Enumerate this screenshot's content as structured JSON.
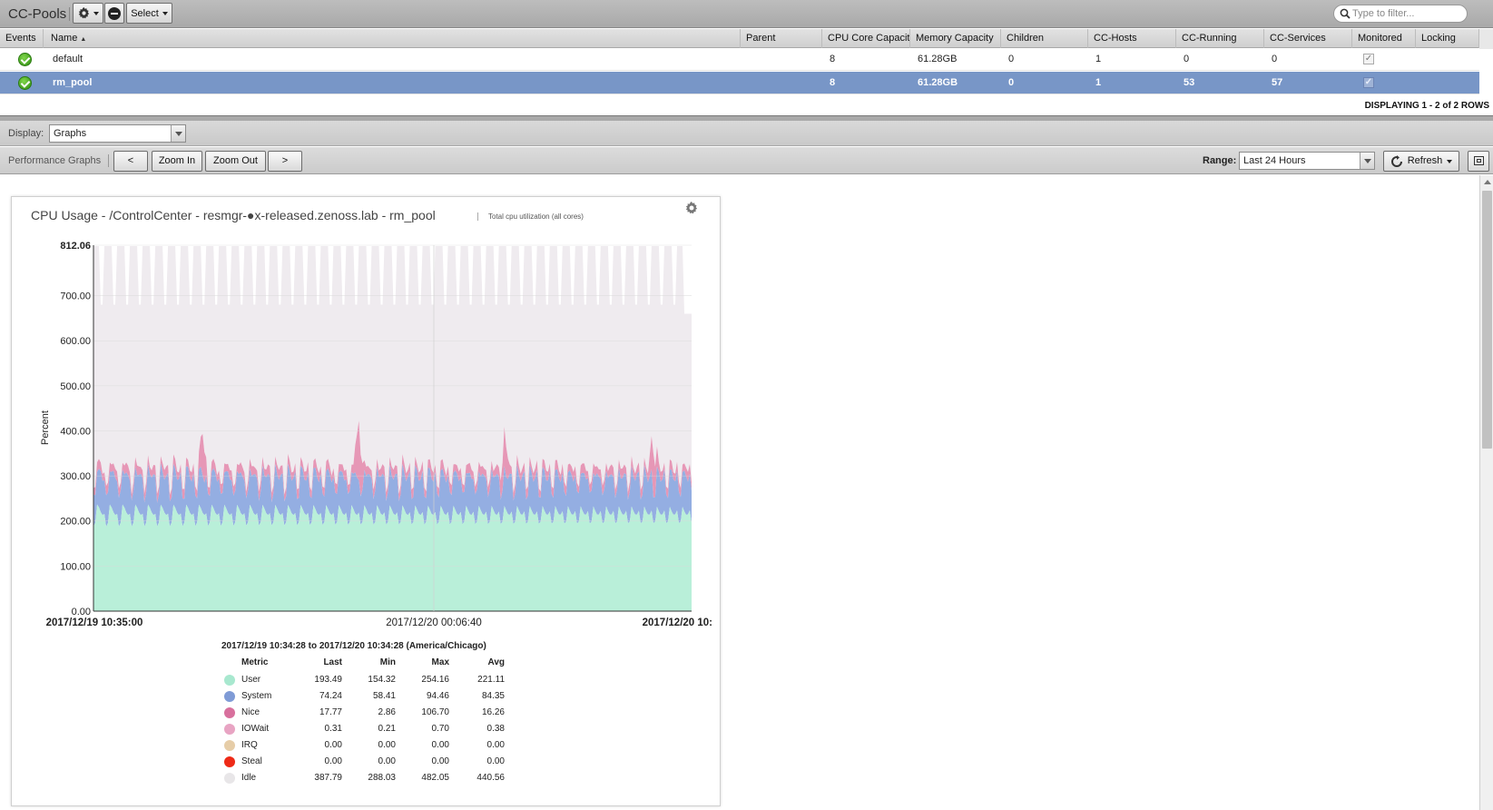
{
  "toolbar": {
    "title": "CC-Pools",
    "select_label": "Select",
    "search_placeholder": "Type to filter..."
  },
  "grid": {
    "columns": [
      "Events",
      "Name",
      "Parent",
      "CPU Core Capacity",
      "Memory Capacity",
      "Children",
      "CC-Hosts",
      "CC-Running",
      "CC-Services",
      "Monitored",
      "Locking"
    ],
    "sort_indicator": "▲",
    "rows": [
      {
        "name": "default",
        "parent": "",
        "cpu": "8",
        "memory": "61.28GB",
        "children": "0",
        "hosts": "1",
        "running": "0",
        "services": "0",
        "monitored_mark": "✓",
        "selected": false
      },
      {
        "name": "rm_pool",
        "parent": "",
        "cpu": "8",
        "memory": "61.28GB",
        "children": "0",
        "hosts": "1",
        "running": "53",
        "services": "57",
        "monitored_mark": "✓",
        "selected": true
      }
    ],
    "displaying": "DISPLAYING 1 - 2 of 2 ROWS"
  },
  "display": {
    "label": "Display:",
    "value": "Graphs"
  },
  "perf": {
    "label": "Performance Graphs",
    "prev_label": "<",
    "zoom_in_label": "Zoom In",
    "zoom_out_label": "Zoom Out",
    "next_label": ">",
    "range_label": "Range:",
    "range_value": "Last 24 Hours",
    "refresh_label": "Refresh"
  },
  "graph": {
    "title": "CPU Usage - /ControlCenter - resmgr-●x-released.zenoss.lab - rm_pool",
    "subtitle": "Total cpu utilization (all cores)"
  },
  "chart_data": {
    "type": "area",
    "stacked": true,
    "ylabel": "Percent",
    "ylim": [
      0,
      812.06
    ],
    "yticks": [
      "812.06",
      "700.00",
      "600.00",
      "500.00",
      "400.00",
      "300.00",
      "200.00",
      "100.00",
      "0.00"
    ],
    "xticks": [
      "2017/12/19 10:35:00",
      "2017/12/20 00:06:40",
      "2017/12/20 10:"
    ],
    "grid": true,
    "series": [
      {
        "name": "User",
        "color": "#b9efd9",
        "avg": 221.11
      },
      {
        "name": "System",
        "color": "#94aee2",
        "avg": 84.35
      },
      {
        "name": "Nice",
        "color": "#e697b6",
        "avg": 16.26
      },
      {
        "name": "Idle",
        "color": "#efebef",
        "avg": 440.56
      }
    ]
  },
  "legend": {
    "range_text": "2017/12/19 10:34:28 to 2017/12/20 10:34:28 (America/Chicago)",
    "headers": [
      "Metric",
      "Last",
      "Min",
      "Max",
      "Avg"
    ],
    "rows": [
      {
        "name": "User",
        "color": "#a8e8cf",
        "last": "193.49",
        "min": "154.32",
        "max": "254.16",
        "avg": "221.11"
      },
      {
        "name": "System",
        "color": "#7f9bd6",
        "last": "74.24",
        "min": "58.41",
        "max": "94.46",
        "avg": "84.35"
      },
      {
        "name": "Nice",
        "color": "#d8709d",
        "last": "17.77",
        "min": "2.86",
        "max": "106.70",
        "avg": "16.26"
      },
      {
        "name": "IOWait",
        "color": "#e8a4c3",
        "last": "0.31",
        "min": "0.21",
        "max": "0.70",
        "avg": "0.38"
      },
      {
        "name": "IRQ",
        "color": "#e6cda8",
        "last": "0.00",
        "min": "0.00",
        "max": "0.00",
        "avg": "0.00"
      },
      {
        "name": "Steal",
        "color": "#ee2a17",
        "last": "0.00",
        "min": "0.00",
        "max": "0.00",
        "avg": "0.00"
      },
      {
        "name": "Idle",
        "color": "#e8e6e8",
        "last": "387.79",
        "min": "288.03",
        "max": "482.05",
        "avg": "440.56"
      }
    ]
  }
}
